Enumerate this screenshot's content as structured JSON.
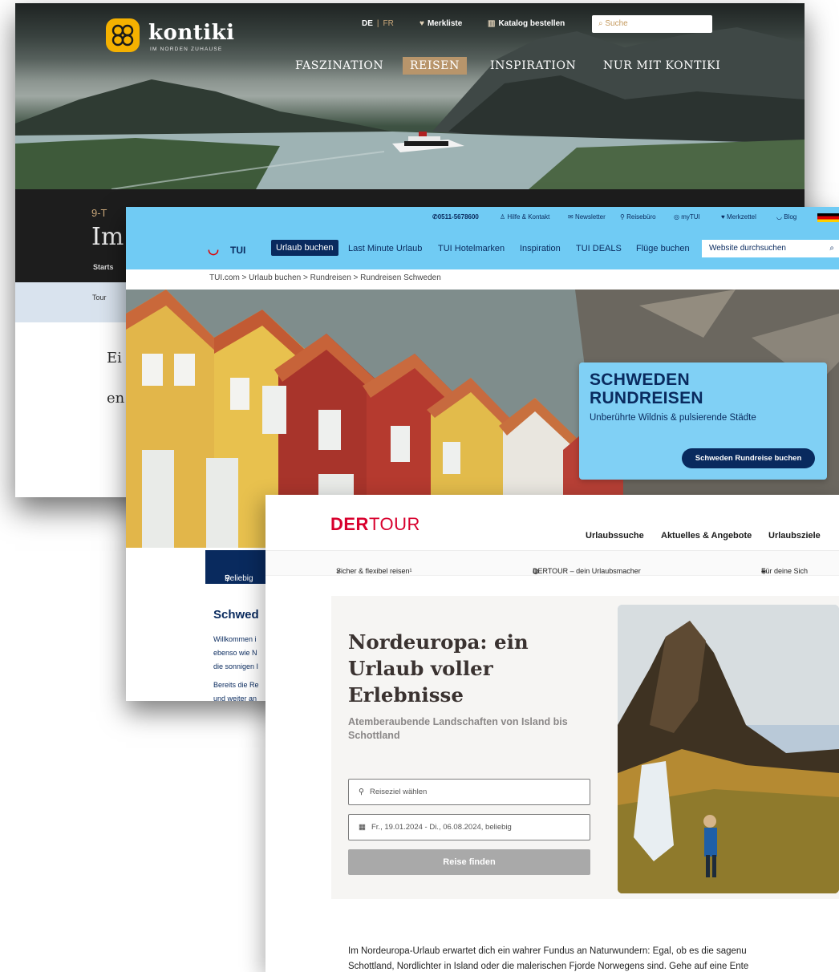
{
  "kontiki": {
    "logo_text": "kontiki",
    "logo_subtitle": "IM NORDEN ZUHAUSE",
    "lang_de": "DE",
    "lang_sep": "|",
    "lang_fr": "FR",
    "merkliste": "Merkliste",
    "katalog": "Katalog bestellen",
    "search_placeholder": "Suche",
    "nav": [
      "FASZINATION",
      "REISEN",
      "INSPIRATION",
      "NUR MIT KONTIKI"
    ],
    "kicker": "9-T",
    "title_partial": "Im",
    "meta_partial": "Starts",
    "tourbar_partial": "Tour",
    "para_line1": "Ei",
    "para_line2": "en"
  },
  "tui": {
    "util": {
      "phone": "0511-5678600",
      "help": "Hilfe & Kontakt",
      "newsletter": "Newsletter",
      "reisebuero": "Reisebüro",
      "mytui": "myTUI",
      "merkzettel": "Merkzettel",
      "blog": "Blog"
    },
    "logo_word": "TUI",
    "nav": [
      "Urlaub buchen",
      "Last Minute Urlaub",
      "TUI Hotelmarken",
      "Inspiration",
      "TUI DEALS",
      "Flüge buchen"
    ],
    "search_placeholder": "Website durchsuchen",
    "breadcrumb": "TUI.com > Urlaub buchen > Rundreisen > Rundreisen Schweden",
    "promo": {
      "line1": "SCHWEDEN",
      "line2": "RUNDREISEN",
      "subtitle": "Unberührte Wildnis & pulsierende Städte",
      "button": "Schweden Rundreise buchen"
    },
    "pick_label": "Beliebig",
    "section_title_partial": "Schwed",
    "text_lines": [
      "Willkommen i",
      "ebenso wie N",
      "die sonnigen I",
      "Bereits die Re",
      "und weiter an"
    ]
  },
  "dertour": {
    "brand_bold": "DER",
    "brand_light": "TOUR",
    "nav": [
      "Urlaubssuche",
      "Aktuelles & Angebote",
      "Urlaubsziele"
    ],
    "usp": [
      "Sicher & flexibel reisen¹",
      "DERTOUR – dein Urlaubsmacher",
      "Für deine Sich"
    ],
    "title": "Nordeuropa: ein Urlaub voller Erlebnisse",
    "subtitle": "Atemberaubende Landschaften von Island bis Schottland",
    "destination_placeholder": "Reiseziel wählen",
    "date_value": "Fr., 19.01.2024 - Di., 06.08.2024, beliebig",
    "find_button": "Reise finden",
    "body_line1": "Im Nordeuropa-Urlaub erwartet dich ein wahrer Fundus an Naturwundern: Egal, ob es die sagenu",
    "body_line2": "Schottland, Nordlichter in Island oder die malerischen Fjorde Norwegens sind. Gehe auf eine Ente"
  },
  "colors": {
    "kontiki_gold": "#f5b100",
    "kontiki_accent": "#b8956b",
    "tui_sky": "#70cbf4",
    "tui_navy": "#092a5e",
    "tui_red": "#e00000",
    "dertour_red": "#d8002d",
    "dertour_button": "#a9a9a9"
  }
}
